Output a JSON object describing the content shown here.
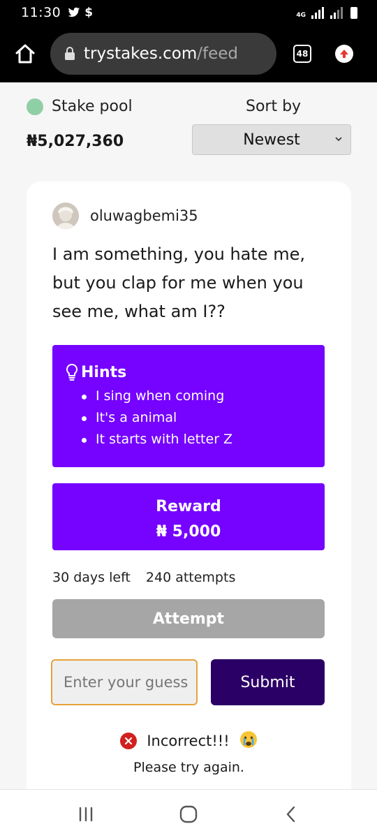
{
  "status_bar": {
    "time": "11:30",
    "network": "4G"
  },
  "browser": {
    "url_host": "trystakes.com",
    "url_path": "/feed",
    "tab_count": "48"
  },
  "header": {
    "pool_label": "Stake pool",
    "pool_amount": "₦5,027,360",
    "sort_label": "Sort by",
    "sort_selected": "Newest"
  },
  "post": {
    "author": "oluwagbemi35",
    "question": "I am something, you hate me, but you clap for me when you see me, what am I??",
    "hints_title": "Hints",
    "hints": [
      "I sing when coming",
      "It's a animal",
      "It starts with letter Z"
    ],
    "reward_label": "Reward",
    "reward_amount": "₦ 5,000",
    "days_left": "30 days left",
    "attempts": "240 attempts",
    "attempt_label": "Attempt",
    "guess_placeholder": "Enter your guess",
    "submit_label": "Submit",
    "result_text": "Incorrect!!!",
    "result_subtext": "Please try again."
  },
  "colors": {
    "accent_purple": "#7503ff",
    "submit_dark": "#2b0066",
    "attempt_gray": "#a6a6a6",
    "pool_dot": "#8fcfa6",
    "error_red": "#d21f1f",
    "input_border": "#e6a33a"
  },
  "icons": {
    "home": "home-icon",
    "lock": "lock-icon",
    "tabs": "tabs-icon",
    "upload": "upload-icon",
    "bulb": "lightbulb-icon",
    "error": "close-circle-icon",
    "emoji": "crying-face-icon",
    "nav_recents": "recents-icon",
    "nav_home": "nav-home-icon",
    "nav_back": "back-icon"
  }
}
